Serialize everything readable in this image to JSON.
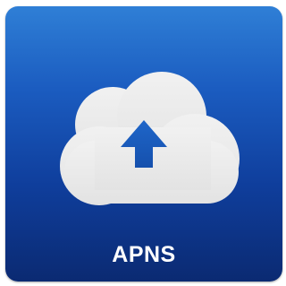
{
  "app": {
    "name": "APNS",
    "icon": "cloud-upload-icon",
    "colors": {
      "background_top": "#2f7fd6",
      "background_bottom": "#0b2a72",
      "cloud": "#ebebeb",
      "arrow": "#1a5bbf",
      "label": "#ffffff"
    }
  }
}
